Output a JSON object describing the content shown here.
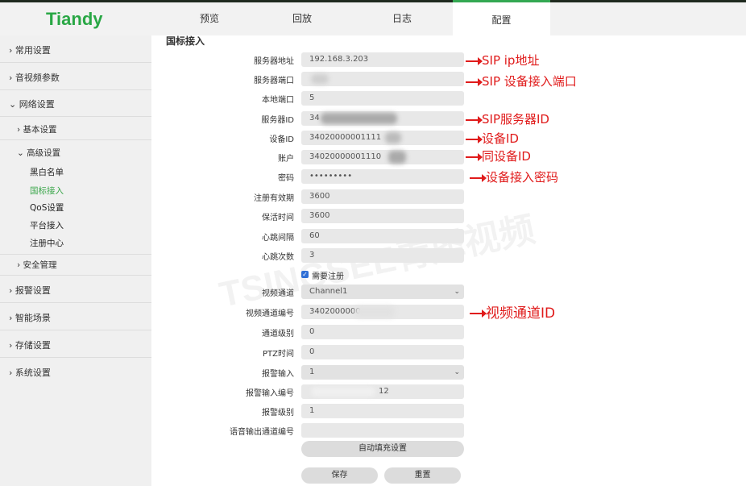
{
  "header": {
    "logo": "Tiandy",
    "tabs": [
      {
        "label": "预览"
      },
      {
        "label": "回放"
      },
      {
        "label": "日志"
      },
      {
        "label": "配置",
        "active": true
      }
    ]
  },
  "sidebar": {
    "items": [
      {
        "label": "常用设置",
        "chevron": "›"
      },
      {
        "label": "音视频参数",
        "chevron": "›"
      },
      {
        "label": "网络设置",
        "chevron": "⌄"
      },
      {
        "label": "基本设置",
        "chevron": "›"
      },
      {
        "label": "高级设置",
        "chevron": "⌄"
      },
      {
        "label": "黑白名单"
      },
      {
        "label": "国标接入",
        "active": true
      },
      {
        "label": "QoS设置"
      },
      {
        "label": "平台接入"
      },
      {
        "label": "注册中心"
      },
      {
        "label": "安全管理",
        "chevron": "›"
      },
      {
        "label": "报警设置",
        "chevron": "›"
      },
      {
        "label": "智能场景",
        "chevron": "›"
      },
      {
        "label": "存储设置",
        "chevron": "›"
      },
      {
        "label": "系统设置",
        "chevron": "›"
      }
    ]
  },
  "form": {
    "section_title": "国标接入",
    "fields": [
      {
        "label": "服务器地址",
        "value": "192.168.3.203"
      },
      {
        "label": "服务器端口",
        "value": ""
      },
      {
        "label": "本地端口",
        "value": "5"
      },
      {
        "label": "服务器ID",
        "value": "34"
      },
      {
        "label": "设备ID",
        "value": "34020000001111"
      },
      {
        "label": "账户",
        "value": "34020000001110"
      },
      {
        "label": "密码",
        "value": "•••••••••"
      },
      {
        "label": "注册有效期",
        "value": "3600"
      },
      {
        "label": "保活时间",
        "value": "3600"
      },
      {
        "label": "心跳间隔",
        "value": "60"
      },
      {
        "label": "心跳次数",
        "value": "3"
      }
    ],
    "register_checkbox_label": "需要注册",
    "fields2": [
      {
        "label": "视频通道",
        "value": "Channel1",
        "select": true
      },
      {
        "label": "视频通道编号",
        "value": "3402000000"
      },
      {
        "label": "通道级别",
        "value": "0"
      },
      {
        "label": "PTZ时间",
        "value": "0"
      },
      {
        "label": "报警输入",
        "value": "1",
        "select": true
      },
      {
        "label": "报警输入编号",
        "value": "12"
      },
      {
        "label": "报警级别",
        "value": "1"
      },
      {
        "label": "语音输出通道编号",
        "value": ""
      }
    ],
    "autofill_button": "自动填充设置",
    "save_button": "保存",
    "reset_button": "重置"
  },
  "annotations": [
    "SIP ip地址",
    "SIP 设备接入端口",
    "SIP服务器ID",
    "设备ID",
    "同设备ID",
    "设备接入密码",
    "视频通道ID"
  ],
  "watermark": "TSINGSEE青犀视频",
  "colors": {
    "brand": "#29a745",
    "annotation": "#e01b1b",
    "active_menu": "#3aa64a"
  }
}
